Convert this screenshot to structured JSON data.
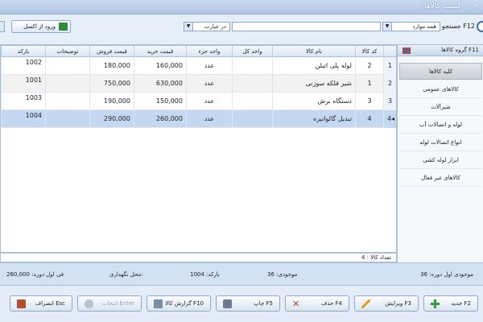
{
  "window": {
    "title": "لیست کالاها",
    "min_glyph": "–"
  },
  "toolbar": {
    "search_label": "جستجو F12",
    "field_select": "همه موارد",
    "mode_select": "در عبارت",
    "excel_label": "ورود از اکسل"
  },
  "sidebar": {
    "header": "گروه کالاها F11",
    "items": [
      {
        "label": "کلیه کالاها"
      },
      {
        "label": "کالاهای عمومی"
      },
      {
        "label": "شیرآلات"
      },
      {
        "label": "لوله و اتصالات آب"
      },
      {
        "label": "انواع اتصالات لوله"
      },
      {
        "label": "ابزار لوله کشی"
      },
      {
        "label": "کالاهای غیر فعال"
      }
    ]
  },
  "table": {
    "columns": {
      "idx": "",
      "code": "کد کالا",
      "name": "نام کالا",
      "unit_whole": "واحد کل",
      "unit_part": "واحد جزء",
      "buy_price": "قیمت خرید",
      "sell_price": "قیمت فروش",
      "description": "توضیحات",
      "barcode": "بارکد"
    },
    "rows": [
      {
        "idx": "1",
        "code": "2",
        "name": "لوله پلی اتیلن",
        "unit_whole": "",
        "unit_part": "عدد",
        "buy_price": "160,000",
        "sell_price": "180,000",
        "description": "",
        "barcode": "1002"
      },
      {
        "idx": "2",
        "code": "1",
        "name": "شیر فلکه سوزنی",
        "unit_whole": "",
        "unit_part": "عدد",
        "buy_price": "630,000",
        "sell_price": "750,000",
        "description": "",
        "barcode": "1001"
      },
      {
        "idx": "3",
        "code": "3",
        "name": "دستگاه برش",
        "unit_whole": "",
        "unit_part": "عدد",
        "buy_price": "150,000",
        "sell_price": "190,000",
        "description": "",
        "barcode": "1003"
      },
      {
        "idx": "4◂",
        "code": "4",
        "name": "تبدیل گالوانیزه",
        "unit_whole": "",
        "unit_part": "عدد",
        "buy_price": "260,000",
        "sell_price": "290,000",
        "description": "",
        "barcode": "1004"
      }
    ],
    "count_text": "تعداد کالا : 4"
  },
  "status": {
    "opening_stock": "موجودی اول دوره: 36",
    "stock": "موجودی: 36",
    "barcode": "بارکد: 1004",
    "storage": "محل نگهداری:",
    "opening_price": "فی اول دوره: 260,000"
  },
  "footer": {
    "new": "جدید F2",
    "edit": "ویرایش F3",
    "delete": "حذف F4",
    "print": "چاپ F5",
    "report": "گزارش کالا F10",
    "select": "انتخاب Enter",
    "cancel": "انصراف Esc"
  }
}
